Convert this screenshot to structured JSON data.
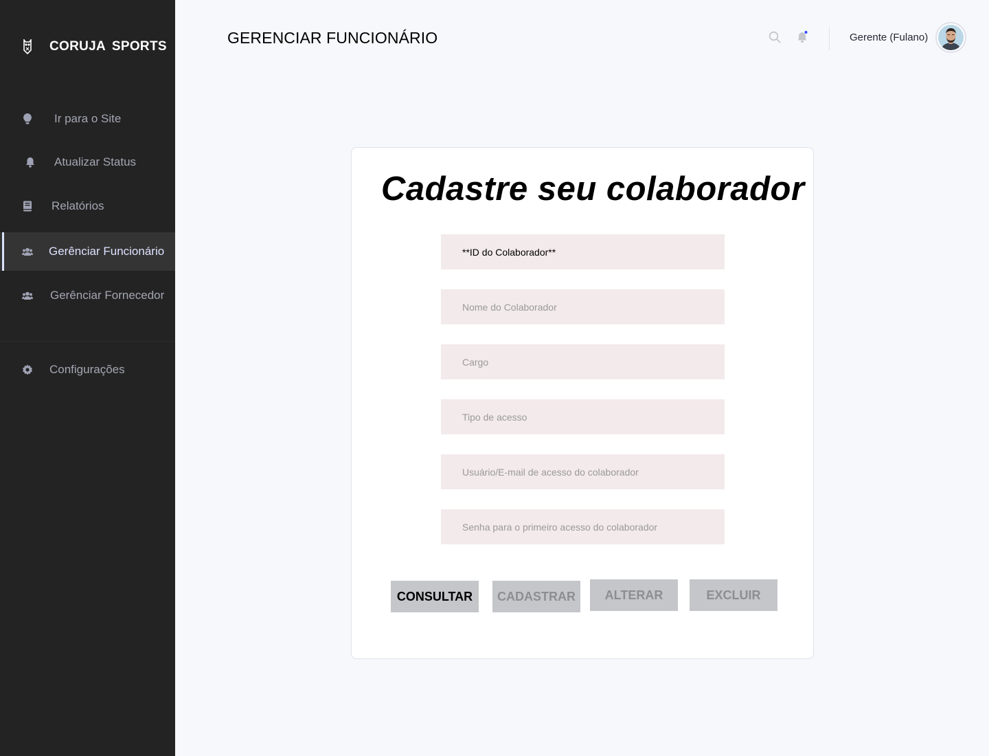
{
  "brand": {
    "name": "CORUJA  SPORTS"
  },
  "sidebar": {
    "items": [
      {
        "label": "Ir para o Site",
        "icon": "lightbulb-icon"
      },
      {
        "label": "Atualizar Status",
        "icon": "bell-icon"
      },
      {
        "label": "Relatórios",
        "icon": "book-icon"
      },
      {
        "label": "Gerênciar Funcionário",
        "icon": "users-icon",
        "active": true
      },
      {
        "label": "Gerênciar Fornecedor",
        "icon": "users-icon"
      }
    ],
    "settings": {
      "label": "Configurações",
      "icon": "gear-icon"
    }
  },
  "header": {
    "title": "GERENCIAR FUNCIONÁRIO",
    "user_name": "Gerente (Fulano)",
    "notification_dot_color": "#3751ff"
  },
  "form": {
    "title": "Cadastre seu colaborador",
    "fields": [
      {
        "placeholder": "**ID do Colaborador**",
        "value": "**ID do Colaborador**"
      },
      {
        "placeholder": "Nome do Colaborador"
      },
      {
        "placeholder": "Cargo"
      },
      {
        "placeholder": "Tipo de acesso"
      },
      {
        "placeholder": "Usuário/E-mail de acesso do colaborador"
      },
      {
        "placeholder": "Senha para o primeiro acesso do colaborador"
      }
    ],
    "buttons": {
      "consultar": "CONSULTAR",
      "cadastrar": "CADASTRAR",
      "alterar": "ALTERAR",
      "excluir": "EXCLUIR"
    }
  }
}
